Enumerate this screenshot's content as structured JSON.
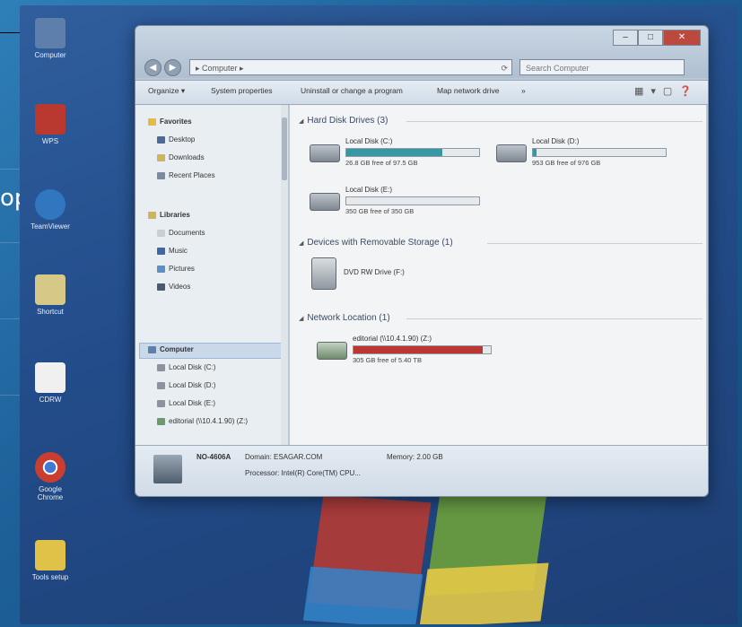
{
  "slide": {
    "partial_text": "op"
  },
  "desktop_icons": [
    {
      "label": "Computer",
      "color": "#5b7fb0"
    },
    {
      "label": "WPS",
      "color": "#c4362c"
    },
    {
      "label": "TeamViewer",
      "color": "#2a78c8"
    },
    {
      "label": "Shortcut",
      "color": "#d8c880"
    },
    {
      "label": "CDRW",
      "color": "#f0f0f0"
    },
    {
      "label": "Google Chrome",
      "color": "#d63b2d"
    },
    {
      "label": "Tools setup",
      "color": "#e2c23a"
    }
  ],
  "window": {
    "address": "Computer",
    "search_placeholder": "Search Computer",
    "buttons": {
      "minimize": "–",
      "maximize": "□",
      "close": "✕"
    },
    "toolbar": [
      "Organize ▾",
      "System properties",
      "Uninstall or change a program",
      "Map network drive",
      "»"
    ]
  },
  "navigation": {
    "favorites": {
      "label": "Favorites",
      "items": [
        "Desktop",
        "Downloads",
        "Recent Places"
      ]
    },
    "libraries": {
      "label": "Libraries",
      "items": [
        "Documents",
        "Music",
        "Pictures",
        "Videos"
      ]
    },
    "computer": {
      "label": "Computer",
      "items": [
        "Local Disk (C:)",
        "Local Disk (D:)",
        "Local Disk (E:)",
        "editorial (\\\\10.4.1.90) (Z:)"
      ]
    }
  },
  "groups": {
    "hdd": {
      "label": "Hard Disk Drives (3)",
      "drives": [
        {
          "name": "Local Disk (C:)",
          "free": "26.8 GB free of 97.5 GB",
          "used_fraction": 0.72,
          "color": "#2e9aa8"
        },
        {
          "name": "Local Disk (D:)",
          "free": "953 GB free of 976 GB",
          "used_fraction": 0.03,
          "color": "#2e9aa8"
        },
        {
          "name": "Local Disk (E:)",
          "free": "350 GB free of 350 GB",
          "used_fraction": 0.0,
          "color": "#2e9aa8"
        }
      ]
    },
    "removable": {
      "label": "Devices with Removable Storage (1)",
      "drives": [
        {
          "name": "DVD RW Drive (F:)"
        }
      ]
    },
    "network": {
      "label": "Network Location (1)",
      "drives": [
        {
          "name": "editorial (\\\\10.4.1.90) (Z:)",
          "free": "305 GB free of 5.40 TB",
          "used_fraction": 0.94,
          "color": "#c8332e"
        }
      ]
    }
  },
  "details": {
    "pc_name": "NO-4606A",
    "domain": "Domain: ESAGAR.COM",
    "memory": "Memory: 2.00 GB",
    "processor": "Processor: Intel(R) Core(TM) CPU..."
  }
}
